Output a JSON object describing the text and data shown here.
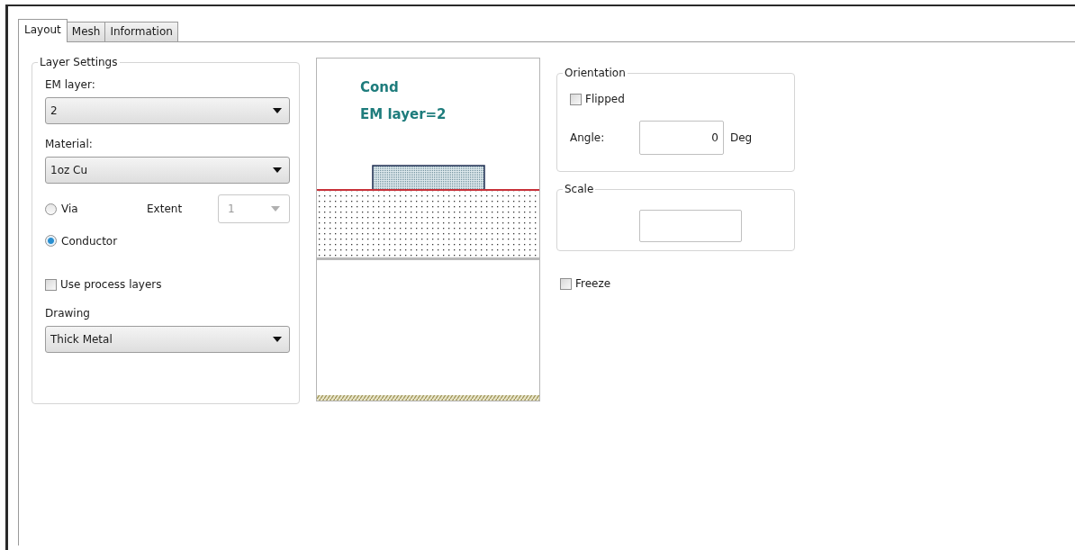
{
  "tabs": [
    {
      "label": "Layout",
      "selected": true
    },
    {
      "label": "Mesh",
      "selected": false
    },
    {
      "label": "Information",
      "selected": false
    }
  ],
  "layer_settings": {
    "title": "Layer Settings",
    "em_layer": {
      "label": "EM layer:",
      "value": "2"
    },
    "material": {
      "label": "Material:",
      "value": "1oz Cu"
    },
    "layer_type": [
      {
        "label": "Via",
        "selected": false
      },
      {
        "label": "Conductor",
        "selected": true
      }
    ],
    "extent": {
      "label": "Extent",
      "value": "1",
      "disabled": true
    },
    "use_process_layers": {
      "label": "Use process layers",
      "checked": false
    },
    "drawing": {
      "label": "Drawing",
      "value": "Thick Metal"
    }
  },
  "preview": {
    "lines": [
      "Cond",
      "EM layer=2"
    ]
  },
  "orientation": {
    "title": "Orientation",
    "flipped": {
      "label": "Flipped",
      "checked": false
    },
    "angle": {
      "label": "Angle:",
      "value": "0",
      "unit": "Deg"
    }
  },
  "scale": {
    "title": "Scale"
  },
  "freeze": {
    "label": "Freeze",
    "checked": false
  }
}
